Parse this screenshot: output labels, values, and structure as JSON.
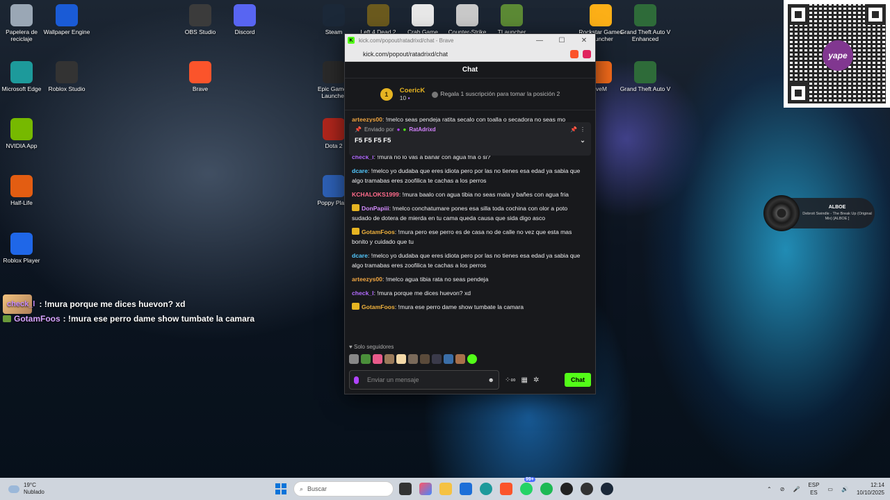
{
  "desktop_icons": [
    {
      "label": "Papelera de reciclaje",
      "icon": "recycle-bin-icon",
      "color": "#9aa7b5"
    },
    {
      "label": "Wallpaper Engine",
      "icon": "wallpaper-engine-icon",
      "color": "#1a5bd6"
    },
    {
      "label": "Microsoft Edge",
      "icon": "edge-icon",
      "color": "#1d9a9b"
    },
    {
      "label": "Roblox Studio",
      "icon": "roblox-studio-icon",
      "color": "#333333"
    },
    {
      "label": "NVIDIA App",
      "icon": "nvidia-icon",
      "color": "#76b900"
    },
    {
      "label": "Half-Life",
      "icon": "half-life-icon",
      "color": "#e35d12"
    },
    {
      "label": "Roblox Player",
      "icon": "roblox-player-icon",
      "color": "#1f67e8"
    },
    {
      "label": "OBS Studio",
      "icon": "obs-icon",
      "color": "#3b3b3b"
    },
    {
      "label": "Discord",
      "icon": "discord-icon",
      "color": "#5865f2"
    },
    {
      "label": "Brave",
      "icon": "brave-icon",
      "color": "#fb542b"
    },
    {
      "label": "Steam",
      "icon": "steam-icon",
      "color": "#1b2838"
    },
    {
      "label": "Epic Games Launcher",
      "icon": "epic-icon",
      "color": "#2a2a2a"
    },
    {
      "label": "Dota 2",
      "icon": "dota-icon",
      "color": "#b0261c"
    },
    {
      "label": "Poppy Playti",
      "icon": "poppy-playtime-icon",
      "color": "#2d60b5"
    },
    {
      "label": "Left 4 Dead 2",
      "icon": "l4d2-icon",
      "color": "#6b5a1e"
    },
    {
      "label": "Crab Game",
      "icon": "crab-game-icon",
      "color": "#e8e8e8"
    },
    {
      "label": "Counter-Strike",
      "icon": "cs-icon",
      "color": "#c9c9c9"
    },
    {
      "label": "TLauncher",
      "icon": "tlauncher-icon",
      "color": "#5c8a35"
    },
    {
      "label": "Rockstar Games Launcher",
      "icon": "rockstar-icon",
      "color": "#fcaf17"
    },
    {
      "label": "Grand Theft Auto V Enhanced",
      "icon": "gta-icon",
      "color": "#2e6b39"
    },
    {
      "label": "iveM",
      "icon": "fivem-icon",
      "color": "#f26a1b"
    },
    {
      "label": "Grand Theft Auto V",
      "icon": "gta-icon",
      "color": "#2e6b39"
    }
  ],
  "browser": {
    "title": "kick.com/popout/ratadrixd/chat - Brave",
    "url": "kick.com/popout/ratadrixd/chat"
  },
  "chat": {
    "header": "Chat",
    "leader_rank": "1",
    "leader_name": "CoericK",
    "leader_count": "10",
    "gift_text": "Regala 1 suscripción para tomar la posición 2",
    "pinned_label": "Enviado por",
    "pinned_user": "RatAdrixd",
    "pinned_text": "F5 F5 F5 F5",
    "messages": [
      {
        "user": "arteezys00",
        "color": "#f2a742",
        "crown": false,
        "text": " !melco seas pendeja ratita secalo con toalla o secadora no seas mo"
      },
      {
        "user": "GotamFoos",
        "color": "#f2b33d",
        "crown": true,
        "text": " !mura pero ese perro es de casa no de calle no vez que esta mas bonito y cuidado que tu"
      },
      {
        "user": "check_l",
        "color": "#b36bff",
        "crown": false,
        "text": " !mura no lo vas a bañar con agua fria o si?"
      },
      {
        "user": "dcare",
        "color": "#53c9ff",
        "crown": false,
        "text": " !melco yo dudaba que eres idiota pero por las no tienes esa edad ya sabia que algo tramabas eres zoofilica te cachas a los perros"
      },
      {
        "user": "KCHALOKS1999",
        "color": "#ff6b8b",
        "crown": false,
        "text": " !mura baalo con agua tibia no seas mala y bañes con agua fria"
      },
      {
        "user": "DonPapiii",
        "color": "#d48cff",
        "crown": true,
        "text": " !melco conchatumare pones esa silla toda cochina con olor a poto sudado de dotera de mierda en tu cama queda causa que sida digo asco"
      },
      {
        "user": "GotamFoos",
        "color": "#f2b33d",
        "crown": true,
        "text": " !mura pero ese perro es de casa no de calle no vez que esta mas bonito y cuidado que tu"
      },
      {
        "user": "dcare",
        "color": "#53c9ff",
        "crown": false,
        "text": " !melco yo dudaba que eres idiota pero por las no tienes esa edad ya sabia que algo tramabas eres zoofilica te cachas a los perros"
      },
      {
        "user": "arteezys00",
        "color": "#f2a742",
        "crown": false,
        "text": " !melco agua tibia rata no seas pendeja"
      },
      {
        "user": "check_l",
        "color": "#b36bff",
        "crown": false,
        "text": " !mura porque me dices huevon? xd"
      },
      {
        "user": "GotamFoos",
        "color": "#f2b33d",
        "crown": true,
        "text": " !mura ese perro dame show tumbate la camara"
      }
    ],
    "followers_only": "Solo seguidores",
    "input_placeholder": "Enviar un mensaje",
    "send_label": "Chat"
  },
  "overlay": [
    {
      "user": "check_l",
      "text": ": !mura porque me dices huevon? xd"
    },
    {
      "user": "GotamFoos",
      "text": ": !mura ese perro dame show tumbate la camara"
    }
  ],
  "music": {
    "artist": "ALBOE",
    "track": "Debroit Swindle - The Break Up (Original Mix) [ALBOE ]"
  },
  "taskbar": {
    "temp": "19°C",
    "weather": "Nublado",
    "search": "Buscar",
    "lang_top": "ESP",
    "lang_bottom": "ES",
    "time": "12:14",
    "date": "10/10/2025",
    "badge": "99+"
  }
}
